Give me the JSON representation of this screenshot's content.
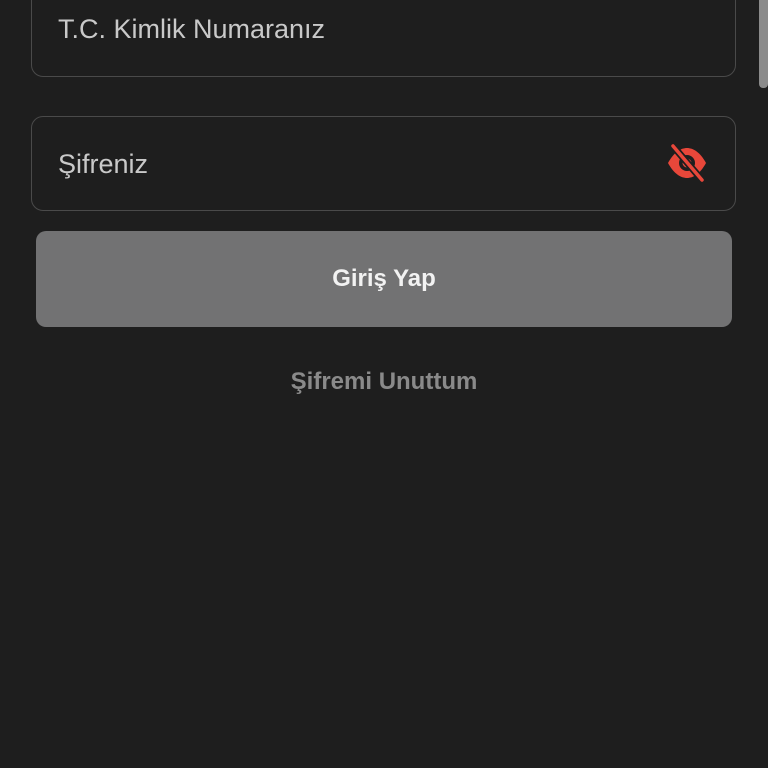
{
  "form": {
    "id_field": {
      "placeholder": "T.C. Kimlik Numaranız",
      "value": ""
    },
    "password_field": {
      "placeholder": "Şifreniz",
      "value": "",
      "toggle_icon": "eye-off-icon"
    },
    "login_button": {
      "label": "Giriş Yap"
    },
    "forgot_link": {
      "label": "Şifremi Unuttum"
    }
  },
  "colors": {
    "background": "#1e1e1e",
    "border": "#4a4a4a",
    "button": "#727273",
    "accent": "#e8473a",
    "link": "#8a8a8a"
  }
}
